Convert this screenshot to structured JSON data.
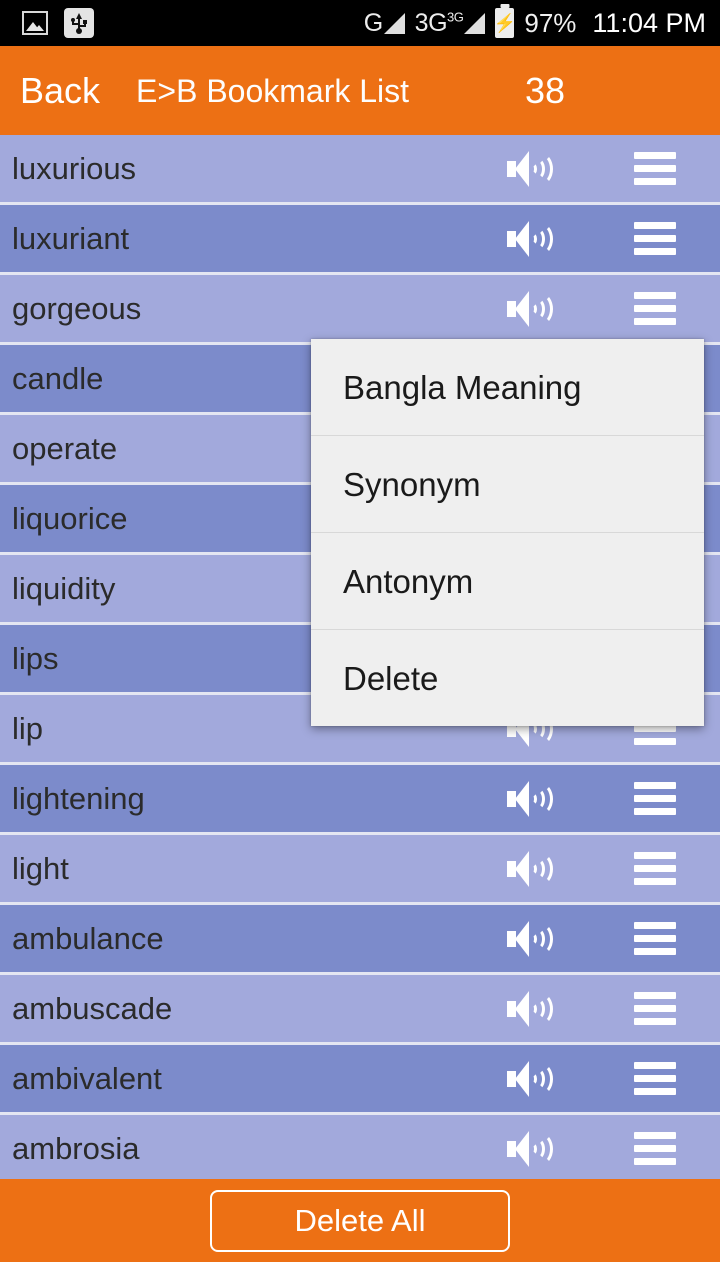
{
  "status_bar": {
    "left_icons": [
      {
        "name": "gallery-icon",
        "label": "gallery"
      },
      {
        "name": "usb-icon",
        "label": "usb"
      }
    ],
    "network_1": "G",
    "network_2": "3G",
    "network_2_sup": "3G",
    "battery_icon": "battery-charging-icon",
    "battery_percent": "97%",
    "time": "11:04 PM",
    "background": "#000000",
    "text_color": "#ededed"
  },
  "appbar": {
    "back_label": "Back",
    "title": "E>B Bookmark List",
    "count": "38",
    "background": "#ed7014",
    "text_color": "#ffffff"
  },
  "list": {
    "row_light_color": "#a2a9dc",
    "row_dark_color": "#7c8bcb",
    "divider_color": "#e4e6f2",
    "speaker_icon": "speaker-icon",
    "menu_icon": "hamburger-menu-icon",
    "rows": [
      {
        "word": "luxurious",
        "shade": "light"
      },
      {
        "word": "luxuriant",
        "shade": "dark"
      },
      {
        "word": "gorgeous",
        "shade": "light"
      },
      {
        "word": "candle",
        "shade": "dark"
      },
      {
        "word": "operate",
        "shade": "light"
      },
      {
        "word": "liquorice",
        "shade": "dark"
      },
      {
        "word": "liquidity",
        "shade": "light"
      },
      {
        "word": "lips",
        "shade": "dark"
      },
      {
        "word": "lip",
        "shade": "light"
      },
      {
        "word": "lightening",
        "shade": "dark"
      },
      {
        "word": "light",
        "shade": "light"
      },
      {
        "word": "ambulance",
        "shade": "dark"
      },
      {
        "word": "ambuscade",
        "shade": "light"
      },
      {
        "word": "ambivalent",
        "shade": "dark"
      },
      {
        "word": "ambrosia",
        "shade": "light"
      }
    ]
  },
  "popup_menu": {
    "background": "#efefef",
    "items": [
      {
        "label": "Bangla Meaning"
      },
      {
        "label": "Synonym"
      },
      {
        "label": "Antonym"
      },
      {
        "label": "Delete"
      }
    ]
  },
  "bottom_bar": {
    "delete_all_label": "Delete All",
    "background": "#ed7014"
  }
}
